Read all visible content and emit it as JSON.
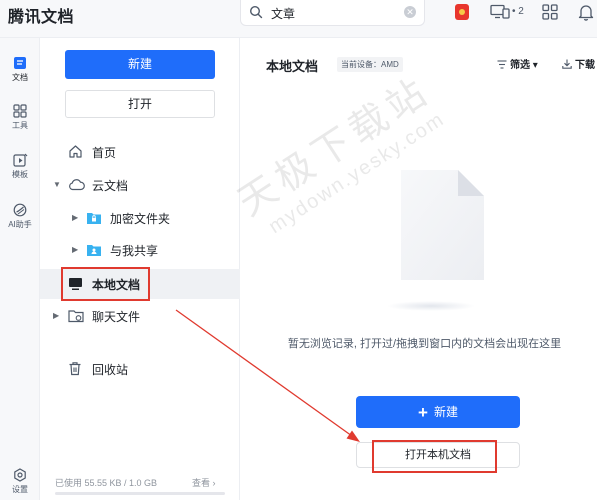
{
  "app": {
    "title": "腾讯文档"
  },
  "search": {
    "value": "文章"
  },
  "topbar": {
    "device_count": "• 2"
  },
  "rail": {
    "items": [
      {
        "label": "文档",
        "icon": "document-icon"
      },
      {
        "label": "工具",
        "icon": "tools-grid-icon"
      },
      {
        "label": "模板",
        "icon": "template-icon"
      },
      {
        "label": "AI助手",
        "icon": "ai-assistant-icon"
      },
      {
        "label": "设置",
        "icon": "settings-icon"
      }
    ]
  },
  "sidebar": {
    "new_label": "新建",
    "open_label": "打开",
    "nav": [
      {
        "label": "首页",
        "icon": "home-icon"
      },
      {
        "label": "云文档",
        "icon": "cloud-icon"
      },
      {
        "label": "加密文件夹",
        "icon": "encrypted-folder-icon"
      },
      {
        "label": "与我共享",
        "icon": "shared-folder-icon"
      },
      {
        "label": "本地文档",
        "icon": "monitor-icon"
      },
      {
        "label": "聊天文件",
        "icon": "chat-file-icon"
      },
      {
        "label": "回收站",
        "icon": "trash-icon"
      }
    ],
    "storage": {
      "text": "已使用 55.55 KB / 1.0 GB",
      "view_label": "查看 ›",
      "used_fraction": 0.0001
    }
  },
  "main": {
    "title": "本地文档",
    "device_tag": "当前设备：AMD",
    "filter_label": "筛选 ▾",
    "download_label": "下载",
    "empty_text": "暂无浏览记录, 打开过/拖拽到窗口内的文档会出现在这里",
    "new_label": "新建",
    "open_local_label": "打开本机文档"
  },
  "watermark": {
    "line1": "天极下载站",
    "line2": "mydown.yesky.com"
  },
  "colors": {
    "accent": "#1f6dfa",
    "annotation": "#e03a2f"
  }
}
